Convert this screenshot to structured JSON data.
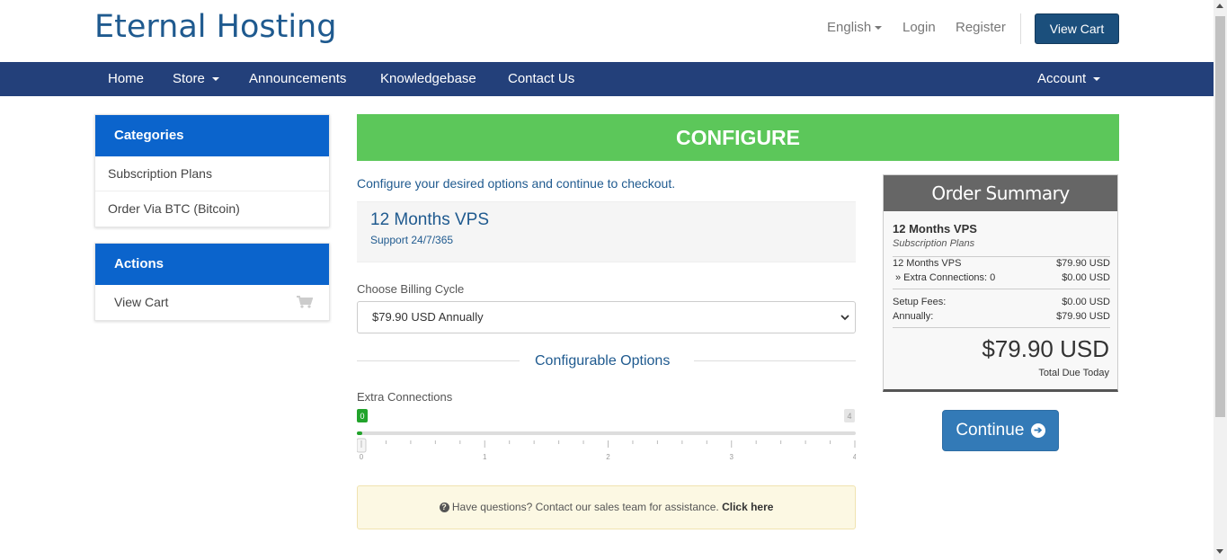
{
  "brand": {
    "name": "Eternal Hosting"
  },
  "topbar": {
    "language": "English",
    "login": "Login",
    "register": "Register",
    "view_cart": "View Cart"
  },
  "nav": {
    "home": "Home",
    "store": "Store",
    "announcements": "Announcements",
    "knowledgebase": "Knowledgebase",
    "contact": "Contact Us",
    "account": "Account"
  },
  "sidebar": {
    "categories_title": "Categories",
    "categories": [
      "Subscription Plans",
      "Order Via BTC (Bitcoin)"
    ],
    "actions_title": "Actions",
    "actions": [
      "View Cart"
    ]
  },
  "main": {
    "banner": "CONFIGURE",
    "intro": "Configure your desired options and continue to checkout.",
    "product_name": "12 Months VPS",
    "product_tagline": "Support 24/7/365",
    "billing_label": "Choose Billing Cycle",
    "billing_value": "$79.90 USD Annually",
    "configurable_title": "Configurable Options",
    "extra_label": "Extra Connections",
    "slider": {
      "value": 0,
      "min": 0,
      "max": 4,
      "min_label": "0",
      "max_label": "4",
      "tick_labels": [
        "0",
        "1",
        "2",
        "3",
        "4"
      ]
    },
    "help_text": "Have questions? Contact our sales team for assistance.",
    "help_link": "Click here"
  },
  "summary": {
    "title": "Order Summary",
    "product": "12 Months VPS",
    "group": "Subscription Plans",
    "line_product": "12 Months VPS",
    "line_product_price": "$79.90 USD",
    "line_extra": "» Extra Connections: 0",
    "line_extra_price": "$0.00 USD",
    "setup_label": "Setup Fees:",
    "setup_price": "$0.00 USD",
    "annual_label": "Annually:",
    "annual_price": "$79.90 USD",
    "total": "$79.90 USD",
    "total_label": "Total Due Today",
    "continue": "Continue"
  },
  "colors": {
    "nav": "#23407a",
    "panel_head": "#0b64cc",
    "banner": "#5cc75a",
    "slider_accent": "#22a32b",
    "continue": "#337ab7"
  }
}
